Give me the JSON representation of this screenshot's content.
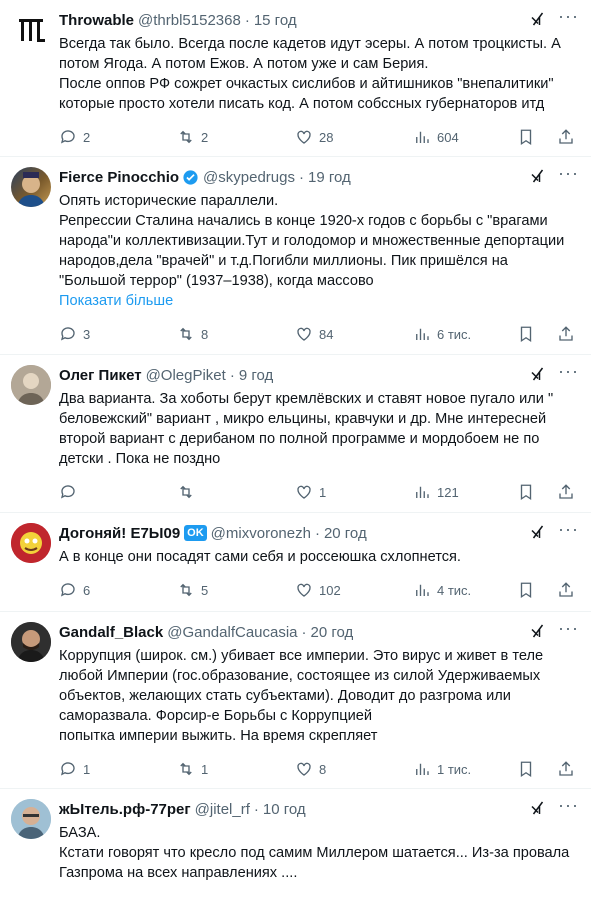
{
  "tweets": [
    {
      "name": "Throwable",
      "handle": "@thrbl5152368",
      "time": "15 год",
      "lines": [
        "Всегда так было. Всегда после кадетов идут эсеры. А потом троцкисты. А потом Ягода. А потом Ежов. А потом уже и сам Берия.",
        "После оппов РФ сожрет очкастых сислибов и айтишников \"внепалитики\" которые просто хотели писать код. А потом собссных губернаторов итд"
      ],
      "replies": "2",
      "reposts": "2",
      "likes": "28",
      "views": "604"
    },
    {
      "name": "Fierce Pinocchio",
      "handle": "@skypedrugs",
      "time": "19 год",
      "verified": true,
      "lines": [
        "Опять исторические параллели.",
        "Репрессии Сталина начались в конце 1920-х годов с борьбы с \"врагами народа\"и коллективизации.Тут и голодомор и множественные депортации народов,дела \"врачей\" и т.д.Погибли миллионы. Пик пришёлся на \"Большой террор\" (1937–1938), когда массово"
      ],
      "show_more": "Показати більше",
      "replies": "3",
      "reposts": "8",
      "likes": "84",
      "views": "6 тис."
    },
    {
      "name": "Олег Пикет",
      "handle": "@OlegPiket",
      "time": "9 год",
      "lines": [
        "Два варианта.  За хоботы берут кремлёвских и ставят новое пугало или \" беловежский\" вариант , микро ельцины, кравчуки и др.  Мне интересней второй вариант с дерибаном по полной программе и мордобоем не по детски . Пока не поздно"
      ],
      "replies": "",
      "reposts": "",
      "likes": "1",
      "views": "121"
    },
    {
      "name": "Догоняй! Е7Ы09",
      "badge": "OK",
      "handle": "@mixvoronezh",
      "time": "20 год",
      "lines": [
        "А в конце они посадят сами себя и россеюшка схлопнется."
      ],
      "replies": "6",
      "reposts": "5",
      "likes": "102",
      "views": "4 тис."
    },
    {
      "name": "Gandalf_Black",
      "handle": "@GandalfCaucasia",
      "time": "20 год",
      "lines": [
        "Коррупция (широк. см.) убивает все империи. Это вирус и живет в теле любой Империи (гос.образование, состоящее из силой Удерживаемых объектов, желающих стать субъектами). Доводит до разгрома или саморазвала. Форсир-е Борьбы с Коррупцией",
        "попытка империи выжить. На время скрепляет"
      ],
      "replies": "1",
      "reposts": "1",
      "likes": "8",
      "views": "1 тис."
    },
    {
      "name": "жЫтель.рф-77рег",
      "handle": "@jitel_rf",
      "time": "10 год",
      "lines": [
        "БАЗА.",
        "Кстати говорят что кресло под самим Миллером шатается... Из-за провала Газпрома на всех направлениях ...."
      ]
    }
  ],
  "colors": {
    "accent": "#1d9bf0",
    "muted": "#536471",
    "text": "#0f1419",
    "border": "#eff3f4"
  }
}
